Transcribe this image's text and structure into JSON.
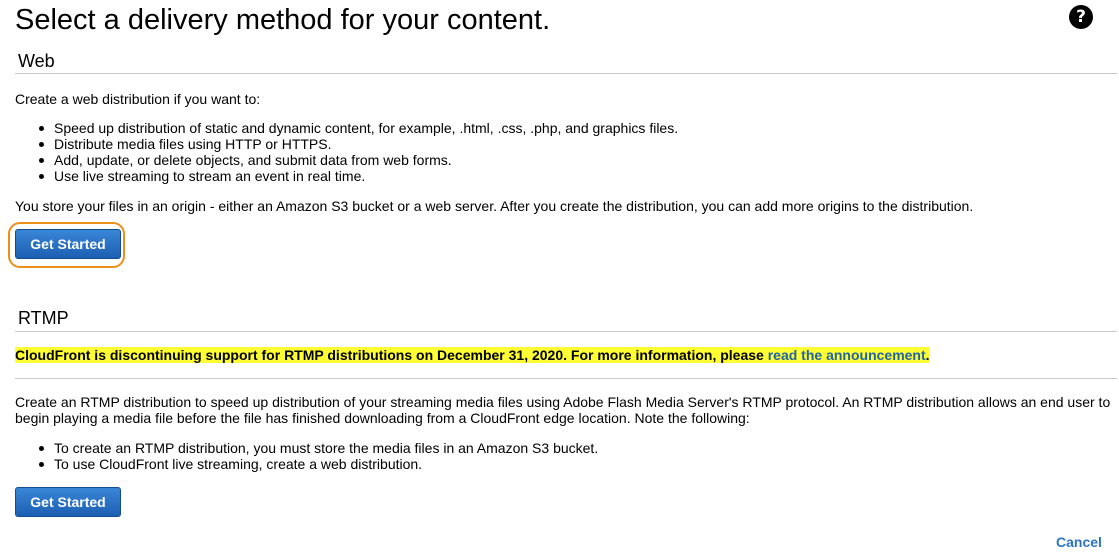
{
  "page_title": "Select a delivery method for your content.",
  "help_icon": {
    "icon": "help-icon",
    "glyph": "?"
  },
  "web": {
    "heading": "Web",
    "intro": "Create a web distribution if you want to:",
    "bullets": [
      "Speed up distribution of static and dynamic content, for example, .html, .css, .php, and graphics files.",
      "Distribute media files using HTTP or HTTPS.",
      "Add, update, or delete objects, and submit data from web forms.",
      "Use live streaming to stream an event in real time."
    ],
    "origin_note": "You store your files in an origin - either an Amazon S3 bucket or a web server. After you create the distribution, you can add more origins to the distribution.",
    "button_label": "Get Started"
  },
  "rtmp": {
    "heading": "RTMP",
    "notice_text": "CloudFront is discontinuing support for RTMP distributions on December 31, 2020. For more information, please ",
    "notice_link": "read the announcement",
    "notice_end": ".",
    "description": "Create an RTMP distribution to speed up distribution of your streaming media files using Adobe Flash Media Server's RTMP protocol. An RTMP distribution allows an end user to begin playing a media file before the file has finished downloading from a CloudFront edge location. Note the following:",
    "bullets": [
      "To create an RTMP distribution, you must store the media files in an Amazon S3 bucket.",
      "To use CloudFront live streaming, create a web distribution."
    ],
    "button_label": "Get Started"
  },
  "cancel_label": "Cancel",
  "colors": {
    "button_top": "#3a86d6",
    "button_bottom": "#1c5fb3",
    "focus_ring": "#ec8f1a",
    "highlight": "#ffff33",
    "link": "#1f63a8"
  }
}
